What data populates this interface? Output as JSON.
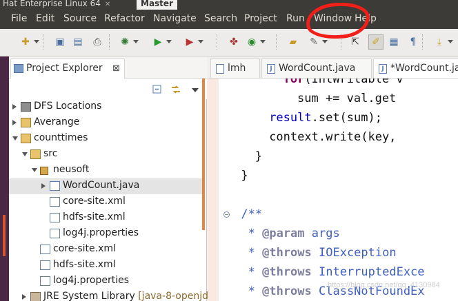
{
  "window_tabs": [
    {
      "label": "Hat Enterprise Linux 64",
      "active": false
    },
    {
      "label": "Master",
      "active": true
    }
  ],
  "menu": [
    "File",
    "Edit",
    "Source",
    "Refactor",
    "Navigate",
    "Search",
    "Project",
    "Run",
    "Window",
    "Help"
  ],
  "toolbar_icons": [
    "new-icon",
    "save-icon",
    "save-all-icon",
    "print-icon",
    "debug-icon",
    "run-icon",
    "run-config-icon",
    "new-java-package-icon",
    "new-class-icon",
    "open-type-icon",
    "search-icon",
    "perspective-icon",
    "mark-occurrences-icon",
    "block-selection-icon",
    "show-whitespace-icon",
    "next-annotation-icon"
  ],
  "explorer": {
    "title": "Project Explorer",
    "tree": [
      {
        "label": "DFS Locations",
        "deco": "",
        "depth": 0,
        "twisty": "closed",
        "icon": "dfs-icon"
      },
      {
        "label": "Averange",
        "deco": "",
        "depth": 0,
        "twisty": "closed",
        "icon": "project-icon"
      },
      {
        "label": "counttimes",
        "deco": "",
        "depth": 0,
        "twisty": "open",
        "icon": "project-icon"
      },
      {
        "label": "src",
        "deco": "",
        "depth": 1,
        "twisty": "open",
        "icon": "source-folder-icon"
      },
      {
        "label": "neusoft",
        "deco": "",
        "depth": 2,
        "twisty": "open",
        "icon": "package-icon"
      },
      {
        "label": "WordCount.java",
        "deco": "",
        "depth": 3,
        "twisty": "closed",
        "icon": "java-file-icon",
        "selected": true
      },
      {
        "label": "core-site.xml",
        "deco": "",
        "depth": 3,
        "twisty": "",
        "icon": "file-icon"
      },
      {
        "label": "hdfs-site.xml",
        "deco": "",
        "depth": 3,
        "twisty": "",
        "icon": "file-icon"
      },
      {
        "label": "log4j.properties",
        "deco": "",
        "depth": 3,
        "twisty": "",
        "icon": "file-icon"
      },
      {
        "label": "core-site.xml",
        "deco": "",
        "depth": 2,
        "twisty": "",
        "icon": "file-icon"
      },
      {
        "label": "hdfs-site.xml",
        "deco": "",
        "depth": 2,
        "twisty": "",
        "icon": "file-icon"
      },
      {
        "label": "log4j.properties",
        "deco": "",
        "depth": 2,
        "twisty": "",
        "icon": "file-icon"
      },
      {
        "label": "JRE System Library ",
        "deco": "[java-8-openjdk",
        "depth": 1,
        "twisty": "closed",
        "icon": "library-icon"
      }
    ]
  },
  "editor": {
    "tabs": [
      {
        "label": "lmh",
        "active": false
      },
      {
        "label": "WordCount.java",
        "active": false
      },
      {
        "label": "*WordCount.java",
        "active": true
      }
    ],
    "lines": [
      {
        "indent": 4,
        "parts": [
          [
            "kw",
            "for"
          ],
          [
            "",
            "(IntWritable v"
          ]
        ]
      },
      {
        "indent": 5,
        "parts": [
          [
            "",
            "sum += val.get"
          ]
        ]
      },
      {
        "indent": 3,
        "parts": [
          [
            "fld",
            "result"
          ],
          [
            "",
            ".set(sum);"
          ]
        ]
      },
      {
        "indent": 3,
        "parts": [
          [
            "",
            "context.write(key,"
          ]
        ]
      },
      {
        "indent": 2,
        "parts": [
          [
            "",
            "}"
          ]
        ]
      },
      {
        "indent": 1,
        "parts": [
          [
            "",
            "}"
          ]
        ]
      },
      {
        "indent": 0,
        "parts": [
          [
            "",
            ""
          ]
        ]
      },
      {
        "indent": 1,
        "parts": [
          [
            "doc",
            "/**"
          ]
        ]
      },
      {
        "indent": 1,
        "parts": [
          [
            "doc",
            " * "
          ],
          [
            "tag",
            "@param"
          ],
          [
            "doc",
            " args"
          ]
        ]
      },
      {
        "indent": 1,
        "parts": [
          [
            "doc",
            " * "
          ],
          [
            "tag",
            "@throws"
          ],
          [
            "doc",
            " IOException"
          ]
        ]
      },
      {
        "indent": 1,
        "parts": [
          [
            "doc",
            " * "
          ],
          [
            "tag",
            "@throws"
          ],
          [
            "doc",
            " InterruptedExce"
          ]
        ]
      },
      {
        "indent": 1,
        "parts": [
          [
            "doc",
            " * "
          ],
          [
            "tag",
            "@throws"
          ],
          [
            "doc",
            " ClassNotFoundEx"
          ]
        ]
      }
    ]
  },
  "watermark": "https://blog.csdn.net/qq_4130984",
  "colors": {
    "menubar": "#3c3b37",
    "annotation": "#f02018",
    "launcher": "#4b2746",
    "keyword": "#7f0055",
    "javadoc": "#3f5fbf"
  }
}
